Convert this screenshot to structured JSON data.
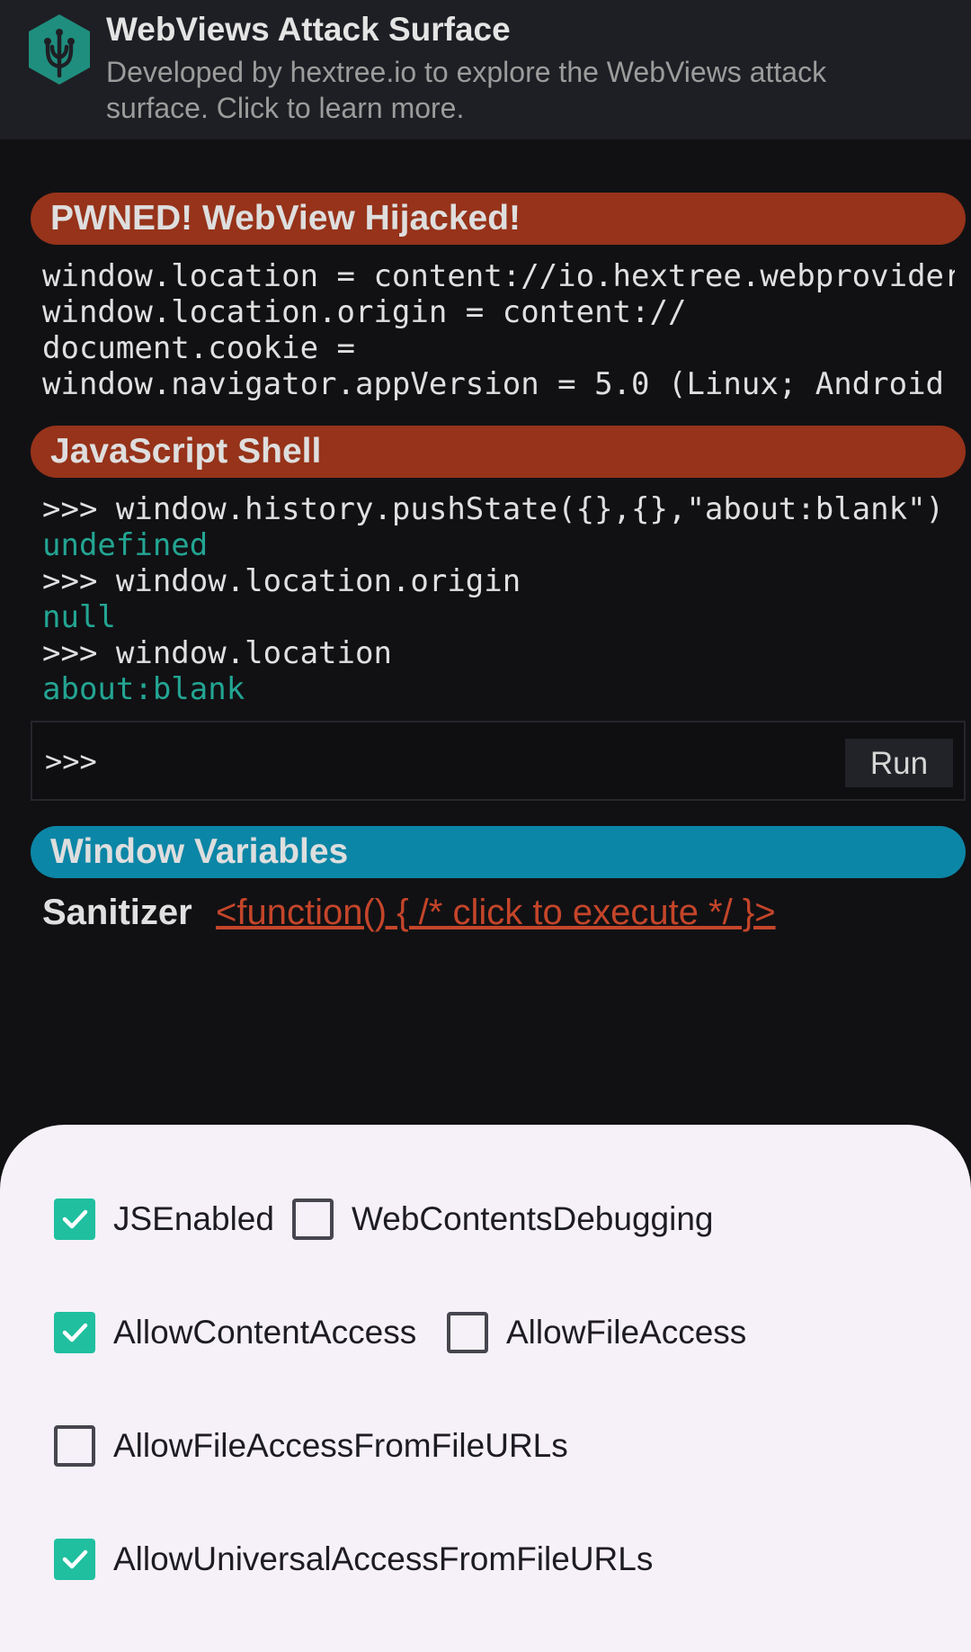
{
  "header": {
    "title": "WebViews Attack Surface",
    "description": "Developed by hextree.io to explore the WebViews attack surface. Click to learn more.",
    "logo_icon": "hextree-tree-logo",
    "accent_color": "#1f8e7e"
  },
  "info_section": {
    "title": "PWNED! WebView Hijacked!",
    "lines": [
      "window.location = content://io.hextree.webprovider",
      "window.location.origin = content://",
      "document.cookie = ",
      "window.navigator.appVersion = 5.0 (Linux; Android"
    ]
  },
  "shell_section": {
    "title": "JavaScript Shell",
    "history": [
      {
        "input": ">>> window.history.pushState({},{},\"about:blank\")",
        "output": "undefined"
      },
      {
        "input": ">>> window.location.origin",
        "output": "null"
      },
      {
        "input": ">>> window.location",
        "output": "about:blank"
      }
    ],
    "prompt": ">>>",
    "run_label": "Run"
  },
  "variables_section": {
    "title": "Window Variables",
    "name": "Sanitizer",
    "value": "<function() { /* click to execute */ }>"
  },
  "settings": {
    "options": [
      {
        "label": "JSEnabled",
        "checked": true
      },
      {
        "label": "WebContentsDebugging",
        "checked": false
      },
      {
        "label": "AllowContentAccess",
        "checked": true
      },
      {
        "label": "AllowFileAccess",
        "checked": false
      },
      {
        "label": "AllowFileAccessFromFileURLs",
        "checked": false
      },
      {
        "label": "AllowUniversalAccessFromFileURLs",
        "checked": true
      }
    ],
    "checked_color": "#1fbf9f"
  }
}
